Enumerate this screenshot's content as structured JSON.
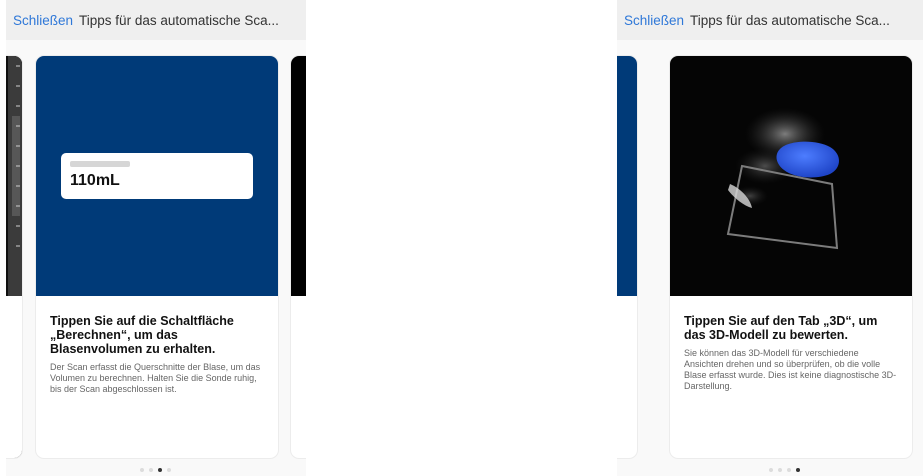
{
  "left_panel": {
    "close_label": "Schließen",
    "title": "Tipps für das automatische Sca...",
    "card": {
      "result_value": "110mL",
      "heading": "Tippen Sie auf die Schaltfläche „Berechnen“, um das Blasenvolumen zu erhalten.",
      "text": "Der Scan erfasst die Querschnitte der Blase, um das Volumen zu berechnen. Halten Sie die Sonde ruhig, bis der Scan abgeschlossen ist."
    },
    "pager": {
      "count": 4,
      "active": 3
    }
  },
  "right_panel": {
    "close_label": "Schließen",
    "title": "Tipps für das automatische Sca...",
    "card": {
      "heading": "Tippen Sie auf den Tab „3D“, um das 3D-Modell zu bewerten.",
      "text": "Sie können das 3D-Modell für verschiedene Ansichten drehen und so überprüfen, ob die volle Blase erfasst wurde. Dies ist keine diagnostische 3D-Darstellung."
    },
    "pager": {
      "count": 4,
      "active": 4
    }
  },
  "colors": {
    "accent": "#2f78d8",
    "card_blue": "#003a78",
    "model_blue": "#2a5ee8"
  }
}
